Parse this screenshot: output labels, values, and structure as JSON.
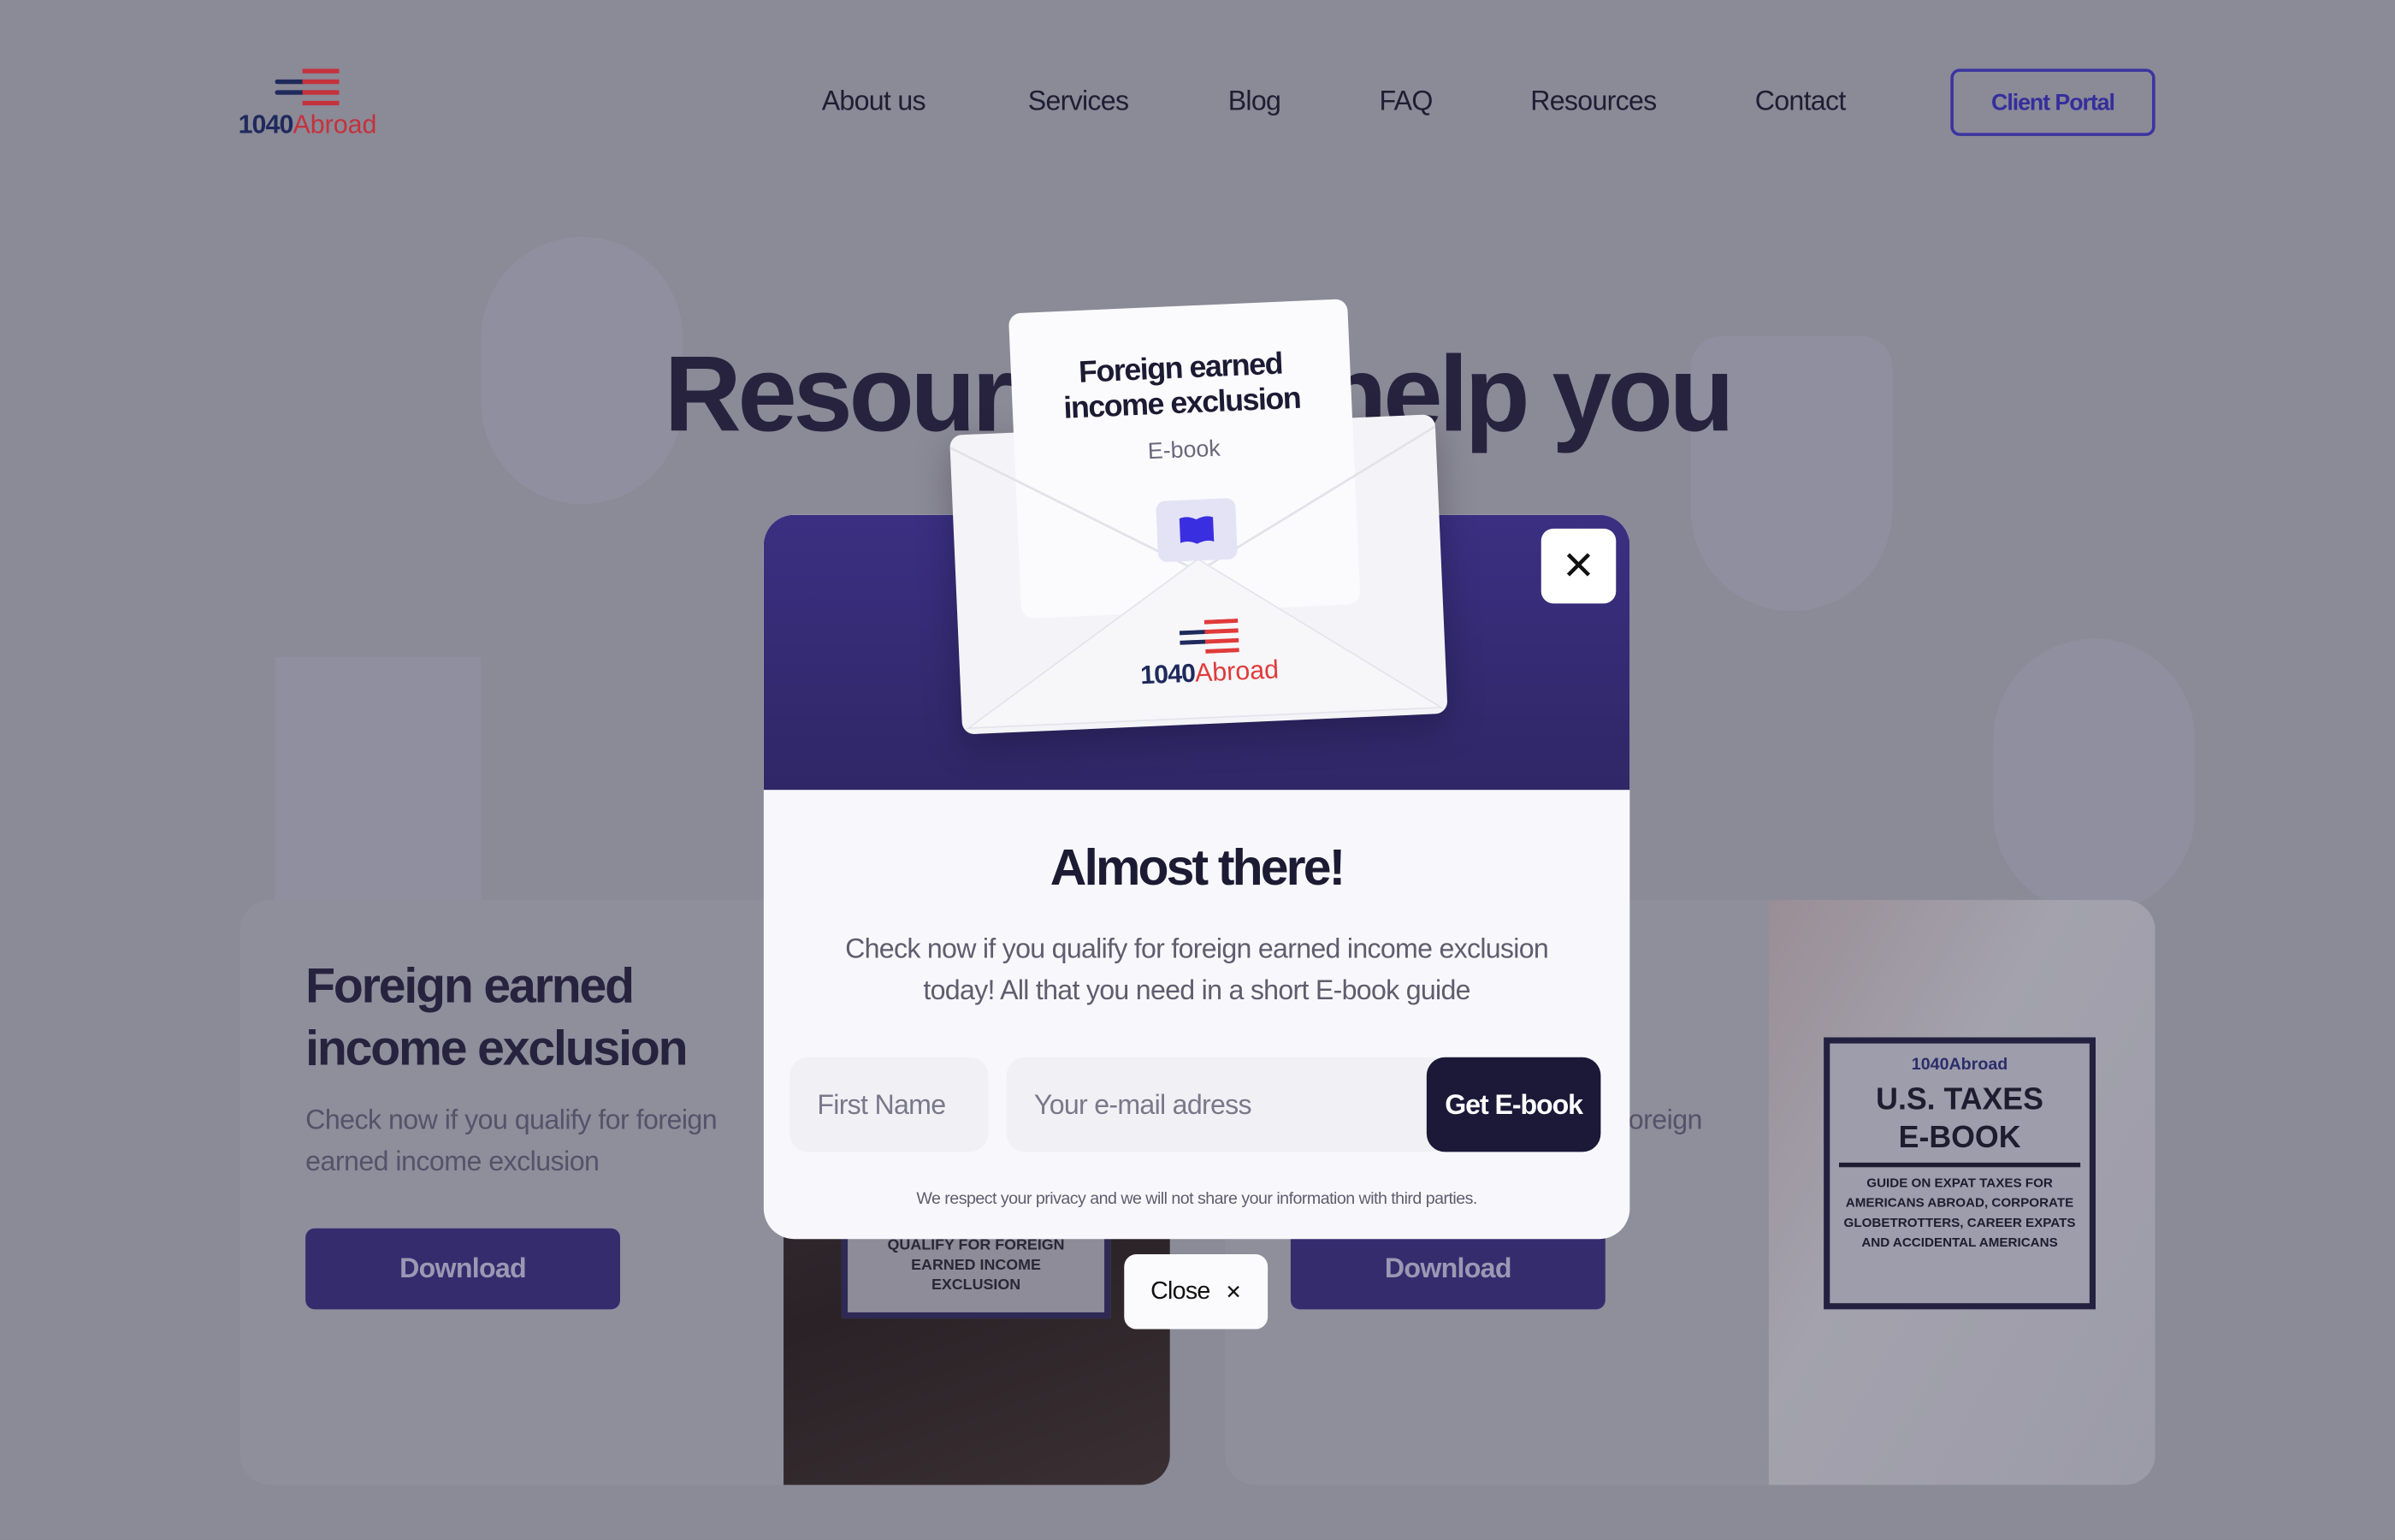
{
  "brand": {
    "num": "1040",
    "name": "Abroad"
  },
  "nav": {
    "items": [
      "About us",
      "Services",
      "Blog",
      "FAQ",
      "Resources",
      "Contact"
    ],
    "portal": "Client Portal"
  },
  "hero": {
    "title": "Resources to help you"
  },
  "cards": [
    {
      "title": "Foreign earned income exclusion",
      "desc": "Check now if you qualify for foreign earned income exclusion",
      "button": "Download",
      "cover_text": "QUALIFY FOR FOREIGN EARNED INCOME EXCLUSION"
    },
    {
      "desc": "Check now if you qualify for foreign",
      "button": "Download",
      "cover": {
        "brand": "1040Abroad",
        "title1": "U.S. TAXES",
        "title2": "E-BOOK",
        "subtitle": "GUIDE ON EXPAT TAXES FOR AMERICANS ABROAD, CORPORATE GLOBETROTTERS, CAREER EXPATS AND ACCIDENTAL AMERICANS"
      }
    }
  ],
  "modal": {
    "envelope": {
      "title": "Foreign earned income exclusion",
      "subtitle": "E-book",
      "icon": "book-icon"
    },
    "close_icon": "✕",
    "title": "Almost there!",
    "desc": "Check now if you qualify for foreign earned income exclusion today! All that you need in a short E-book guide",
    "first_name_placeholder": "First Name",
    "email_placeholder": "Your e-mail adress",
    "submit": "Get E-book",
    "privacy": "We respect your privacy and we will not share your information with third parties.",
    "close_label": "Close",
    "close_x": "✕"
  },
  "colors": {
    "accent": "#352e9c",
    "modal_header": "#3b2f82",
    "submit_bg": "#1c1838",
    "logo_red": "#c4323c",
    "logo_blue": "#1f2a5c"
  }
}
